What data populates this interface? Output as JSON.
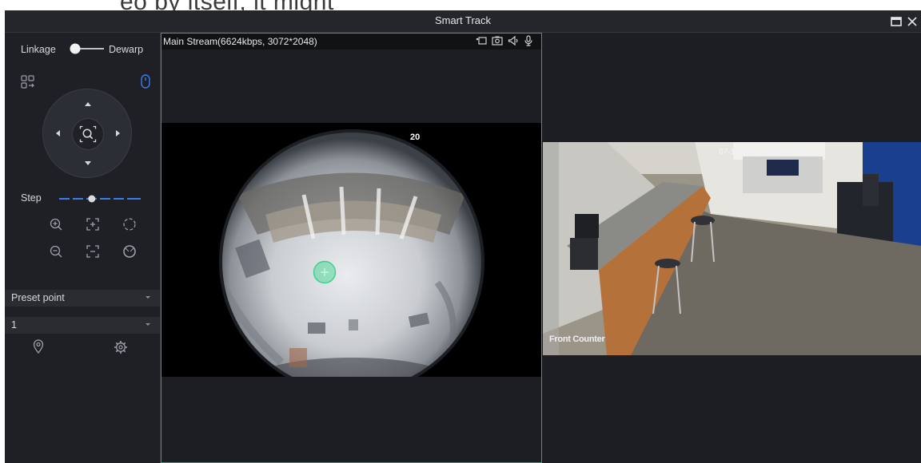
{
  "backdrop": {
    "text": "eo by itself, it might"
  },
  "window": {
    "title": "Smart Track"
  },
  "control_panel": {
    "linkage_label": "Linkage",
    "dewarp_label": "Dewarp",
    "linkage_toggle_on": false,
    "step_label": "Step",
    "step_level_percent": 40,
    "preset": {
      "mode_label": "Preset point",
      "number_value": "1"
    }
  },
  "main_stream": {
    "info": "Main Stream(6624kbps, 3072*2048)",
    "overlay_timestamp": "20"
  },
  "ptz_view": {
    "overlay_timestamp": "07-18-2018 1 8:00:14 AM",
    "overlay_label": "Front Counter"
  },
  "icons": {
    "maximize": "maximize-icon",
    "close": "close-icon",
    "layout": "layout-switch-icon",
    "mouse": "mouse-icon",
    "zoom_in": "zoom-in-icon",
    "zoom_out": "zoom-out-icon",
    "focus_near": "focus-near-icon",
    "focus_far": "focus-far-icon",
    "iris_open": "iris-open-icon",
    "iris_close": "iris-close-icon",
    "preset_goto": "location-pin-icon",
    "preset_settings": "gear-icon",
    "record": "record-icon",
    "snapshot": "camera-icon",
    "audio": "speaker-icon",
    "talk": "microphone-icon"
  },
  "colors": {
    "accent_green": "#1fa97a",
    "slider_blue": "#3d7bf2",
    "panel_bg": "#1e2025",
    "marker_green": "#35d28a"
  }
}
